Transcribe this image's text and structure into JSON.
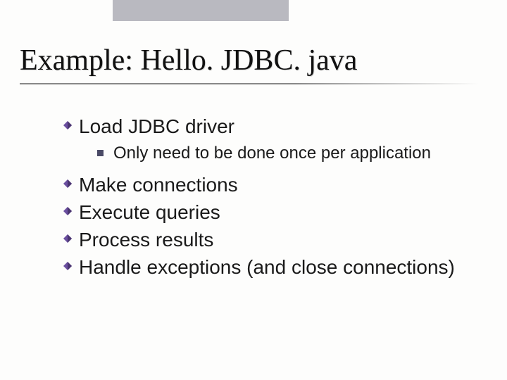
{
  "title": "Example: Hello. JDBC. java",
  "bullets": {
    "b1": "Load JDBC driver",
    "b1_sub": "Only need to be done once per application",
    "b2": "Make connections",
    "b3": "Execute queries",
    "b4": "Process results",
    "b5": "Handle exceptions (and close connections)"
  }
}
